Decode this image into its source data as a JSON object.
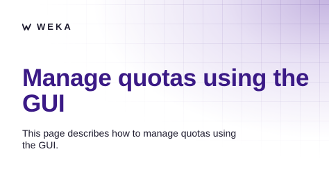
{
  "brand": {
    "logo_text": "WEKA",
    "logo_icon": "weka-logo-mark-icon"
  },
  "page": {
    "title": "Manage quotas using the GUI",
    "description": "This page describes how to manage quotas using the GUI."
  },
  "colors": {
    "title": "#3b1a86",
    "text": "#1d1b2e",
    "accent_gradient": "#9678c8"
  }
}
